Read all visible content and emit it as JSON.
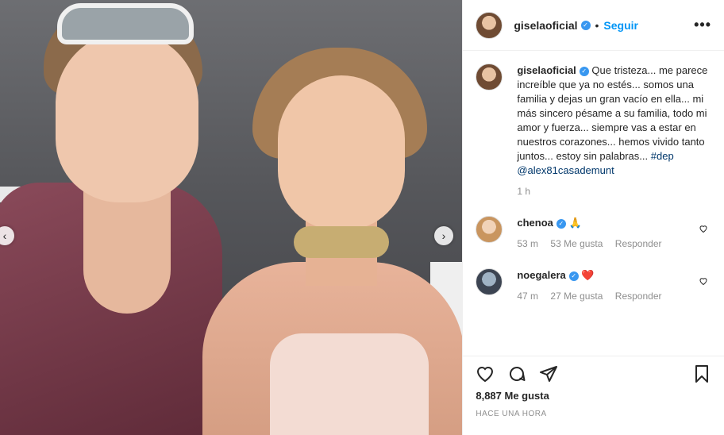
{
  "post": {
    "username": "giselaoficial",
    "follow_label": "Seguir",
    "more_label": "•••",
    "nav_prev": "‹",
    "nav_next": "›",
    "caption": {
      "username": "giselaoficial",
      "text": "Que tristeza... me parece increíble que ya no estés... somos una familia y dejas un gran vacío en ella... mi más sincero pésame a su familia, todo mi amor y fuerza... siempre vas a estar en nuestros corazones... hemos vivido tanto juntos... estoy sin palabras...",
      "hashtag": "#dep",
      "mention": "@alex81casademunt",
      "time": "1 h"
    },
    "comments": [
      {
        "username": "chenoa",
        "emoji": "🙏",
        "time": "53 m",
        "likes": "53 Me gusta",
        "reply": "Responder"
      },
      {
        "username": "noegalera",
        "emoji": "❤️",
        "time": "47 m",
        "likes": "27 Me gusta",
        "reply": "Responder"
      }
    ],
    "likes": "8,887 Me gusta",
    "timestamp": "HACE UNA HORA"
  },
  "colors": {
    "accent": "#0095f6",
    "verified": "#3897f0",
    "muted": "#8e8e8e"
  },
  "icons": [
    "heart-icon",
    "comment-icon",
    "share-icon",
    "bookmark-icon",
    "verified-icon",
    "more-icon",
    "chevron-left-icon",
    "chevron-right-icon"
  ]
}
